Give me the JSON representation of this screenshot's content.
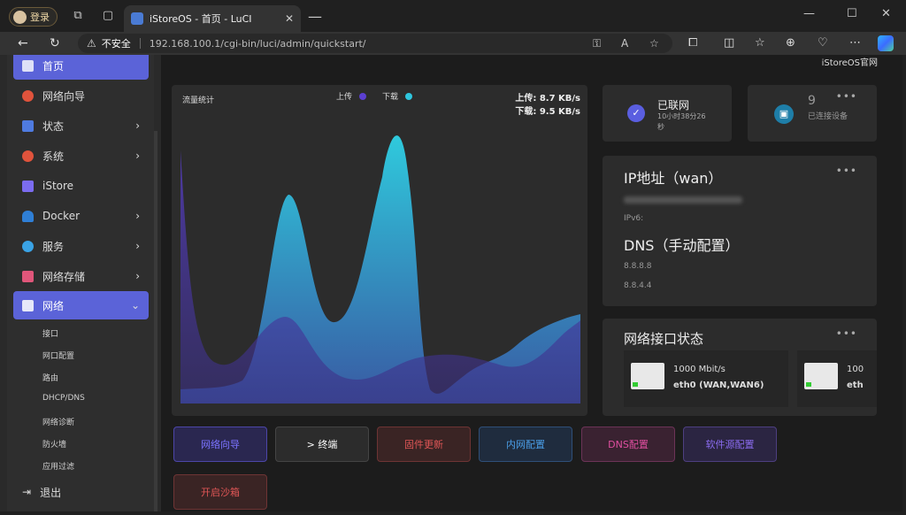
{
  "browser": {
    "profile_label": "登录",
    "tab_title": "iStoreOS - 首页 - LuCI",
    "insecure_label": "不安全",
    "url": "192.168.100.1/cgi-bin/luci/admin/quickstart/"
  },
  "sidebar": {
    "items": [
      {
        "label": "首页"
      },
      {
        "label": "网络向导"
      },
      {
        "label": "状态"
      },
      {
        "label": "系统"
      },
      {
        "label": "iStore"
      },
      {
        "label": "Docker"
      },
      {
        "label": "服务"
      },
      {
        "label": "网络存储"
      },
      {
        "label": "网络"
      }
    ],
    "subitems": [
      "接口",
      "网口配置",
      "路由",
      "DHCP/DNS",
      "网络诊断",
      "防火墙",
      "应用过滤"
    ],
    "logout": "退出"
  },
  "header_note": "iStoreOS官网",
  "traffic": {
    "title": "流量统计",
    "legend_upload": "上传",
    "legend_download": "下载",
    "upload_rate": "上传: 8.7 KB/s",
    "download_rate": "下载: 9.5 KB/s",
    "colors": {
      "upload": "#5b3fd1",
      "download": "#2fc6de"
    }
  },
  "status": {
    "connected": "已联网",
    "duration": "10小时38分26秒"
  },
  "devices": {
    "count": "9",
    "label": "已连接设备"
  },
  "ip": {
    "title": "IP地址（wan）",
    "ipv6_label": "IPv6:",
    "dns_title": "DNS（手动配置）",
    "dns1": "8.8.8.8",
    "dns2": "8.8.4.4"
  },
  "interfaces": {
    "title": "网络接口状态",
    "ports": [
      {
        "speed": "1000 Mbit/s",
        "name": "eth0 (WAN,WAN6)"
      },
      {
        "speed": "100",
        "name": "eth"
      }
    ]
  },
  "quick_actions": [
    {
      "label": "网络向导",
      "color": "#7b73ff",
      "bg": "#2a2750",
      "border": "#4c46a8"
    },
    {
      "label": "> 终端",
      "color": "#ffffff",
      "bg": "#2c2c2c",
      "border": "#444444"
    },
    {
      "label": "固件更新",
      "color": "#e05656",
      "bg": "#3a2424",
      "border": "#6e3434"
    },
    {
      "label": "内网配置",
      "color": "#4a9de6",
      "bg": "#1f2c3e",
      "border": "#2f4f78"
    },
    {
      "label": "DNS配置",
      "color": "#e04fa0",
      "bg": "#3a2231",
      "border": "#6c3357"
    },
    {
      "label": "软件源配置",
      "color": "#8b6cf0",
      "bg": "#2b2542",
      "border": "#4d3f80"
    },
    {
      "label": "开启沙箱",
      "color": "#e05656",
      "bg": "#3a2424",
      "border": "#6e3434"
    }
  ]
}
